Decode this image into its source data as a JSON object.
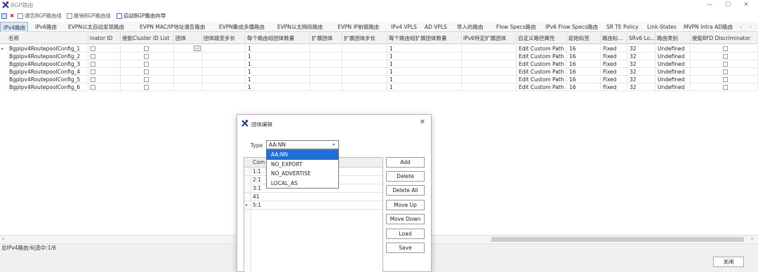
{
  "window": {
    "title": "BGP路由",
    "minimize": "—",
    "maximize": "☐",
    "close": "✕"
  },
  "toolbar": {
    "items": [
      "通告BGP路由组",
      "撤销BGP路由组",
      "启动BGP路由向导"
    ]
  },
  "tabs": [
    "IPv4路由",
    "IPv6路由",
    "EVPN以太自动发现路由",
    "EVPN MAC/IP地址通告路由",
    "EVPN集成多播路由",
    "EVPN以太网段路由",
    "EVPN IP前缀路由",
    "IPv4 VPLS",
    "AD VPLS",
    "导入的路由",
    "Flow Specs路由",
    "IPv6 Flow Specs路由",
    "SR TE Policy",
    "Link-States",
    "MVPN Intra AD路由"
  ],
  "grid": {
    "headers": [
      "名称",
      "inator ID",
      "使能Cluster ID List",
      "团体",
      "团体跳变步长",
      "每个路由组团体数量",
      "扩展团体",
      "扩展团体步长",
      "每个路由组扩展团体数量",
      "IPv6特定扩展团体",
      "自定义路径属性",
      "起始标签",
      "路由标...",
      "SRv6 Lo...",
      "路由类别",
      "使能BFD Discriminator"
    ],
    "rows": [
      [
        "Bgplpv4RoutepoolConfig_1",
        "1",
        "1",
        "Edit Custom Path ...",
        "16",
        "Fixed",
        "32",
        "Undefined"
      ],
      [
        "Bgplpv4RoutepoolConfig_2",
        "1",
        "1",
        "Edit Custom Path ...",
        "16",
        "Fixed",
        "32",
        "Undefined"
      ],
      [
        "Bgplpv4RoutepoolConfig_3",
        "1",
        "1",
        "Edit Custom Path ...",
        "16",
        "Fixed",
        "32",
        "Undefined"
      ],
      [
        "Bgplpv4RoutepoolConfig_4",
        "1",
        "1",
        "Edit Custom Path ...",
        "16",
        "Fixed",
        "32",
        "Undefined"
      ],
      [
        "Bgplpv4RoutepoolConfig_5",
        "1",
        "1",
        "Edit Custom Path ...",
        "16",
        "Fixed",
        "32",
        "Undefined"
      ],
      [
        "Bgplpv4RoutepoolConfig_6",
        "1",
        "1",
        "Edit Custom Path ...",
        "16",
        "Fixed",
        "32",
        "Undefined"
      ]
    ]
  },
  "status": "总IPv4路由:6|选中:1/6",
  "close_button": "关闭",
  "dialog": {
    "title": "团体编辑",
    "type_label": "Type",
    "type_value": "AA:NN",
    "options": [
      "AA:NN",
      "NO_EXPORT",
      "NO_ADVERTISE",
      "LOCAL_AS"
    ],
    "column_header": "Com",
    "values": [
      "1:1",
      "2:1",
      "3:1",
      "41",
      "5:1"
    ],
    "buttons": [
      "Add",
      "Delete",
      "Delete All",
      "Move Up",
      "Move Down",
      "Load",
      "Save"
    ]
  },
  "colors": {
    "selected_option": "#1e6fd9",
    "active_tab": "#d9e8f6"
  }
}
